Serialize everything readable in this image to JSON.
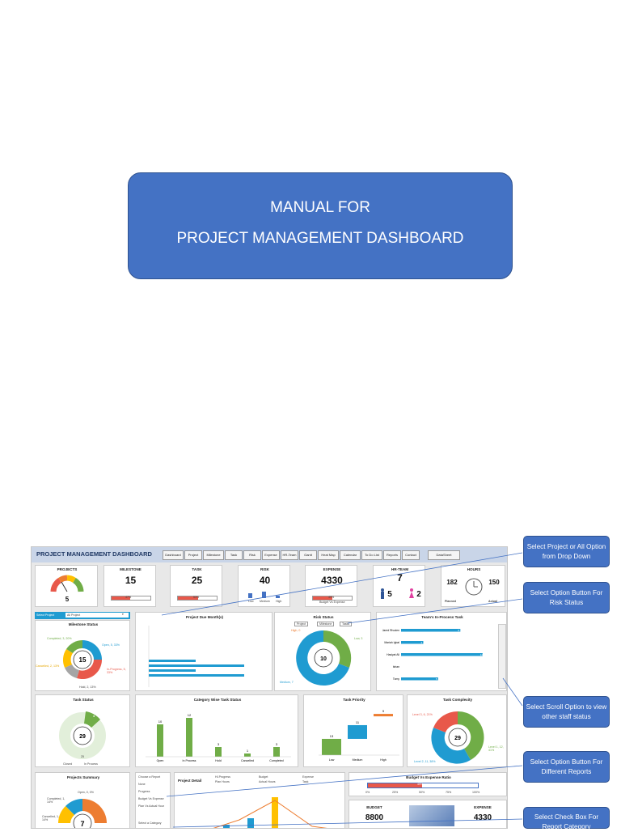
{
  "cover": {
    "line1": "MANUAL FOR",
    "line2": "PROJECT MANAGEMENT DASHBOARD"
  },
  "dashboard": {
    "title": "PROJECT MANAGEMENT DASHBOARD",
    "nav": [
      "Dashboard",
      "Project",
      "Milestone",
      "Task",
      "Risk",
      "Expense",
      "HR-Team",
      "Gantt",
      "Heat Map",
      "Calendar",
      "To Do List",
      "Reports",
      "Contact",
      "DataSheet"
    ],
    "kpis": {
      "projects": {
        "label": "PROJECTS",
        "value": "5"
      },
      "milestone": {
        "label": "MILESTONE",
        "value": "15",
        "pct": "47%"
      },
      "task": {
        "label": "TASK",
        "value": "25",
        "pct": "53%"
      },
      "risk": {
        "label": "RISK",
        "value": "40",
        "levels": [
          "Low",
          "Medium",
          "High"
        ]
      },
      "expense": {
        "label": "EXPENSE",
        "value": "4330",
        "pct": "49%",
        "caption": "Budget Vs Expense"
      },
      "hrteam": {
        "label": "HR-TEAM",
        "value": "7",
        "male": "5",
        "female": "2"
      },
      "hours": {
        "label": "HOURS",
        "planned": "182",
        "actual": "150",
        "planned_label": "Planned",
        "actual_label": "Actual"
      }
    },
    "select_project": {
      "label": "Select Project",
      "value": "All Project"
    },
    "milestone_status": {
      "title": "Milestone Status",
      "center": "15",
      "labels": {
        "open": "Open, 5, 33%",
        "inprogress": "In-Progress, 5, 33%",
        "onhold": "Hold, 2, 13%",
        "cancelled": "Cancelled, 2, 13%",
        "completed": "Completed, 3, 20%"
      }
    },
    "project_due": {
      "title": "Project Due Month(s)"
    },
    "risk_status": {
      "title": "Risk Status",
      "options": [
        "Project",
        "Milestone",
        "Tasks"
      ],
      "center": "10",
      "high": "High, 0",
      "low": "Low, 3",
      "medium": "Medium, 7"
    },
    "team_task": {
      "title": "Team's In-Process Task",
      "names": [
        "Jared Rhoden",
        "Mariah Igbal",
        "Hasiyat Ali",
        "Ishan",
        "Tomy"
      ]
    },
    "task_status": {
      "title": "Task Status",
      "center": "29",
      "value_a": "4",
      "value_b": "25",
      "legend": [
        "Closed",
        "In Process"
      ]
    },
    "category_task": {
      "title": "Category Wise Task Status"
    },
    "task_priority": {
      "title": "Task Priority",
      "axis": [
        "Low",
        "Medium",
        "High"
      ]
    },
    "task_complexity": {
      "title": "Task Complexity",
      "center": "29",
      "l1": "Level 3, 6, 21%",
      "l2": "Level 1, 12, 41%",
      "l3": "Level 2, 11, 38%"
    },
    "projects_summary": {
      "title": "Projects Summary",
      "center": "7",
      "open": "Open, 0, 0%",
      "completed": "Completed, 1, 14%",
      "cancelled": "Cancelled, 1, 14%"
    },
    "reports": {
      "choose": "Choose a Report",
      "options": [
        "None",
        "Progress",
        "Budget Vs Expense",
        "Plan Vs Actual Hour"
      ],
      "select_category": "Select a Category"
    },
    "project_detail": {
      "title": "Project Detail",
      "legend": [
        "Hl-Progress",
        "Budget",
        "Expense",
        "Plan Hours",
        "Actual Hours",
        "Task"
      ]
    },
    "budget_ratio": {
      "title": "Budget Vs Expense Ratio",
      "pct": "49%",
      "axis": [
        "0%",
        "25%",
        "50%",
        "75%",
        "100%"
      ]
    },
    "budget": {
      "label": "BUDGET",
      "value": "8800"
    },
    "expense2": {
      "label": "EXPENSE",
      "value": "4330"
    }
  },
  "chart_data": [
    {
      "type": "bar",
      "title": "Category Wise Task Status",
      "categories": [
        "Open",
        "In Process",
        "Hold",
        "Cancelled",
        "Completed"
      ],
      "values": [
        10,
        12,
        3,
        1,
        3
      ],
      "ylim": [
        0,
        14
      ]
    },
    {
      "type": "bar",
      "title": "Task Priority",
      "categories": [
        "Low",
        "Medium",
        "High"
      ],
      "values": [
        13,
        11,
        9
      ],
      "ylim": [
        0,
        35
      ]
    },
    {
      "type": "bar",
      "title": "Team's In-Process Task",
      "categories": [
        "Jared Rhoden",
        "Mariah Igbal",
        "Hasiyat Ali",
        "Ishan",
        "Tomy"
      ],
      "values": [
        8,
        3,
        11,
        0,
        5
      ],
      "xlim": [
        0,
        12
      ]
    }
  ],
  "callouts": [
    "Select Project or All Option from Drop Down",
    "Select Option Button For Risk Status",
    "Select Scroll Option to view other staff status",
    "Select Option Button For Different Reports",
    "Select Check Box For Report Category"
  ],
  "colors": {
    "accent": "#4472c4",
    "green": "#70ad47",
    "orange": "#ed7d31",
    "blue": "#1f9bd1",
    "red": "#e8584a",
    "yellow": "#ffc000",
    "gray": "#a5a5a5"
  }
}
